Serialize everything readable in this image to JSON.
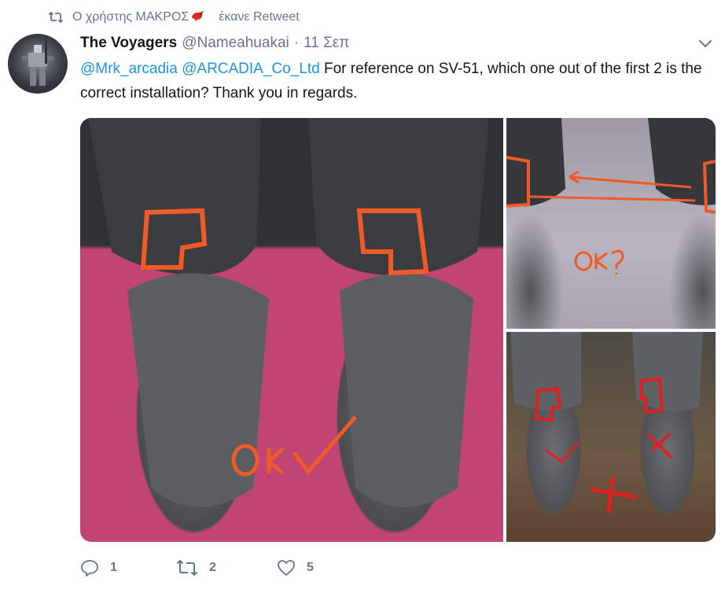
{
  "retweet_context": {
    "prefix": "Ο χρήστης",
    "user_name": "ΜΑΚΡΟΣ",
    "suffix": "έκανε Retweet",
    "icon": "retweet-icon",
    "bird_icon": "red-bird-emoji"
  },
  "tweet": {
    "author_name": "The Voyagers",
    "author_handle": "@Nameahuakai",
    "separator": "·",
    "date": "11 Σεπ",
    "mention_1": "@Mrk_arcadia",
    "mention_2": "@ARCADIA_Co_Ltd",
    "text": " For reference on SV-51, which one out of the first 2 is the correct installation? Thank you in regards.",
    "menu_icon": "chevron-down-icon"
  },
  "media": {
    "images": [
      {
        "description_icon": "photo",
        "annotation": "OK✓"
      },
      {
        "description_icon": "photo",
        "annotation": "OK?"
      },
      {
        "description_icon": "photo",
        "annotation": "X"
      }
    ]
  },
  "actions": {
    "reply_count": "1",
    "retweet_count": "2",
    "like_count": "5"
  },
  "colors": {
    "link": "#1b95e0",
    "muted": "#657786",
    "annotation_orange": "#f05a28",
    "annotation_red": "#e02020"
  }
}
